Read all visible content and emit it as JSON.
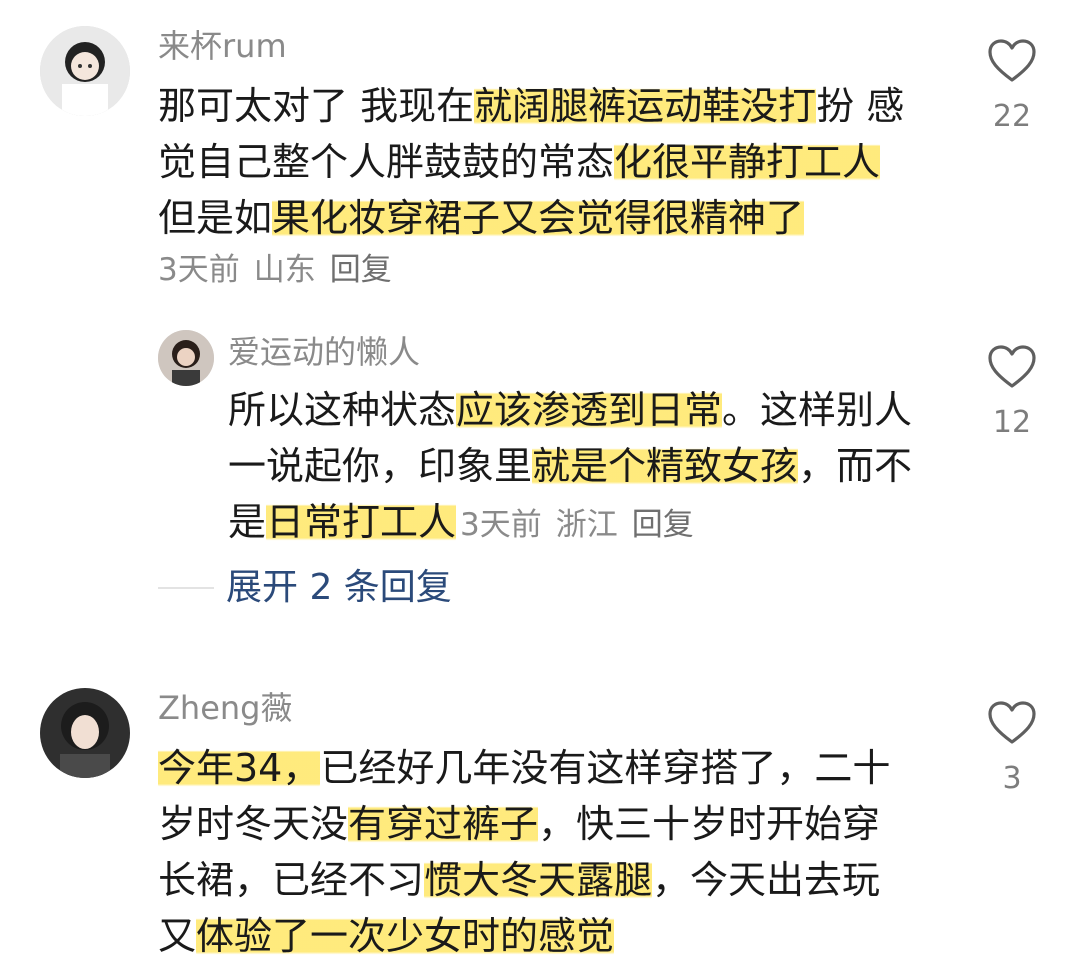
{
  "comments": [
    {
      "username": "来杯rum",
      "lines": [
        [
          "那可太对了 我现在",
          "就阔腿裤运动鞋没打",
          "扮 感"
        ],
        [
          "觉自己整个人胖鼓鼓的常态",
          "化很平静打工人",
          ""
        ],
        [
          "但是如",
          "果化妆穿裙子又会觉得很精神了",
          ""
        ]
      ],
      "time": "3天前",
      "location": "山东",
      "reply_label": "回复",
      "likes": "22",
      "icon": "heart-outline-icon"
    },
    {
      "username": "爱运动的懒人",
      "lines": [
        [
          "所以这种状态",
          "应该渗透到日常",
          "。这样别人"
        ],
        [
          "一说起你，印象里",
          "就是个精致女孩",
          "，而不"
        ],
        [
          "是",
          "日常打工人",
          ""
        ]
      ],
      "time": "3天前",
      "location": "浙江",
      "reply_label": "回复",
      "likes": "12",
      "icon": "heart-outline-icon"
    },
    {
      "username": "Zheng薇",
      "lines": [
        [
          "",
          "今年34，",
          "已经好几年没有这样穿搭了，二十"
        ],
        [
          "岁时冬天没",
          "有穿过裤子",
          "，快三十岁时开始穿"
        ],
        [
          "长裙，已经不习",
          "惯大冬天露腿",
          "，今天出去玩"
        ],
        [
          "又",
          "体验了一次少女时的感觉",
          ""
        ]
      ],
      "likes": "3",
      "icon": "heart-outline-icon"
    }
  ],
  "expand_replies": "展开 2 条回复",
  "colors": {
    "highlight": "#ffe766",
    "username": "#8a8a8a",
    "link": "#2b4a7a",
    "text": "#1a1a1a"
  }
}
